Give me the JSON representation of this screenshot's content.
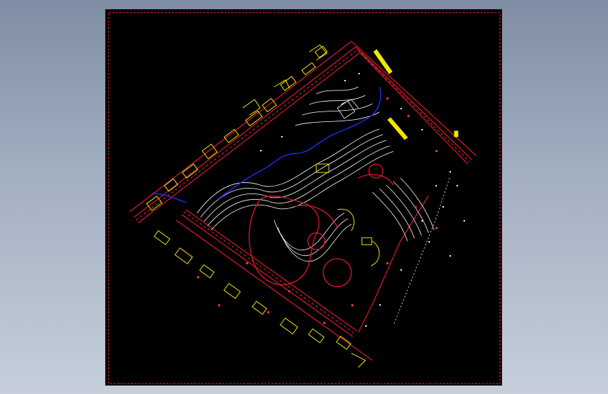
{
  "viewer": {
    "background_color": "#000000",
    "frame_color": "#ff2020"
  },
  "drawing": {
    "type": "site-plan",
    "layer_colors": {
      "roads": "#e0182a",
      "contours": "#ffffff",
      "water": "#1e2cff",
      "buildings": "#f2e600",
      "marks": "#ff3030"
    }
  }
}
